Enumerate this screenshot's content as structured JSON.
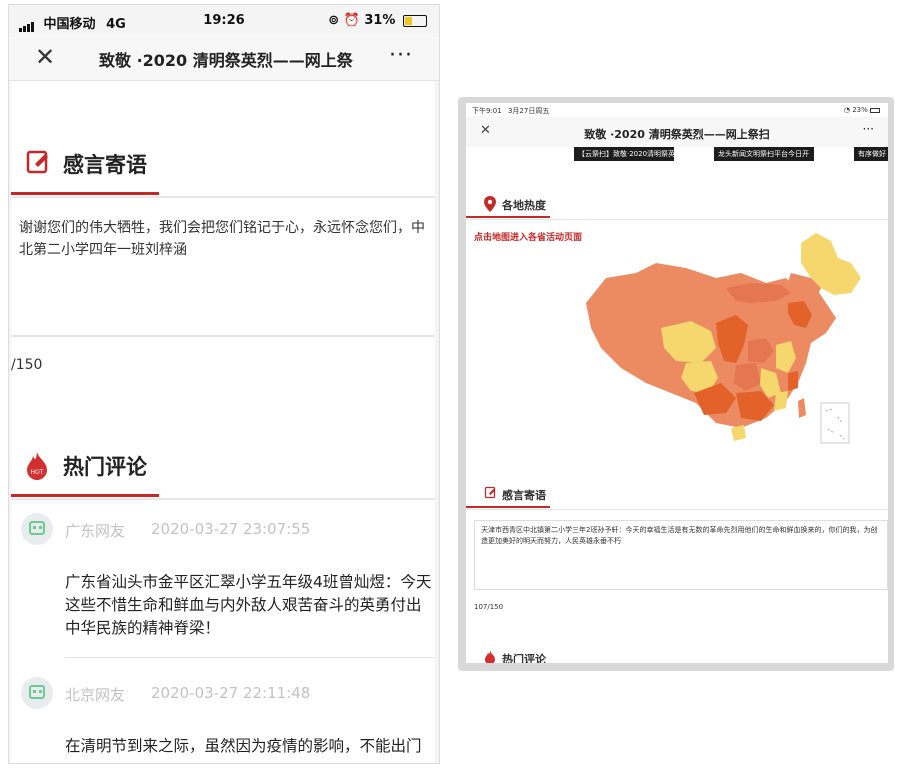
{
  "left": {
    "status": {
      "carrier": "中国移动",
      "network": "4G",
      "time": "19:26",
      "battery": "31%"
    },
    "nav": {
      "title": "致敬 ·2020 清明祭英烈——网上祭"
    },
    "section1": {
      "label": "感言寄语"
    },
    "message": "谢谢您们的伟大牺牲，我们会把您们铭记于心，永远怀念您们，中北第二小学四年一班刘梓涵",
    "count": "/150",
    "section2": {
      "label": "热门评论"
    },
    "comments": [
      {
        "user": "广东网友",
        "date": "2020-03-27 23:07:55",
        "lines": [
          "广东省汕头市金平区汇翠小学五年级4班曾灿煜：今天",
          "这些不惜生命和鲜血与内外敌人艰苦奋斗的英勇付出",
          "中华民族的精神脊梁！"
        ]
      },
      {
        "user": "北京网友",
        "date": "2020-03-27 22:11:48",
        "lines": [
          "在清明节到来之际，虽然因为疫情的影响，不能出门"
        ]
      }
    ]
  },
  "right": {
    "status": {
      "time": "下午9:01",
      "date": "3月27日周五",
      "battery": "23%"
    },
    "nav": {
      "title": "致敬 ·2020 清明祭英烈——网上祭扫"
    },
    "banners": [
      "【云祭扫】致敬·2020清明祭英",
      "龙头新闻文明祭扫平台今日开",
      "有序做好"
    ],
    "section_map": {
      "label": "各地热度"
    },
    "map_hint": "点击地图进入各省活动页面",
    "section_msg": {
      "label": "感言寄语"
    },
    "message": "天津市西青区中北镇第二小学三年2班孙予轩：今天的幸福生活是有无数的革命先烈用他们的生命和鲜血换来的，你们的我，为创造更加美好的明天而努力，人民英雄永垂不朽",
    "count": "107/150",
    "section_hot": {
      "label": "热门评论"
    }
  },
  "colors": {
    "accent": "#c62828",
    "heat_low": "#f5d76e",
    "heat_mid": "#ec8a62",
    "heat_high": "#e2622a"
  }
}
